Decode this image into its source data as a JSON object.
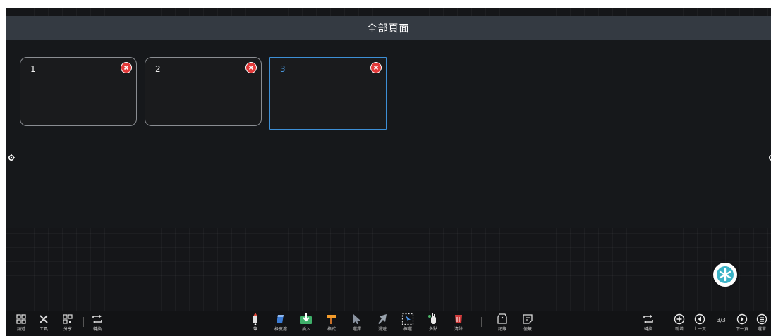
{
  "title": "全部頁面",
  "pages": [
    {
      "number": "1",
      "active": false
    },
    {
      "number": "2",
      "active": false
    },
    {
      "number": "3",
      "active": true
    }
  ],
  "toolbar": {
    "left": [
      {
        "icon": "grid-icon",
        "label": "頻道"
      },
      {
        "icon": "tools-icon",
        "label": "工具"
      },
      {
        "icon": "qrcode-icon",
        "label": "分享"
      },
      {
        "icon": "switch-icon",
        "label": "轉換"
      }
    ],
    "center": [
      {
        "icon": "pen-icon",
        "label": "筆"
      },
      {
        "icon": "eraser-icon",
        "label": "橡皮擦"
      },
      {
        "icon": "insert-icon",
        "label": "插入"
      },
      {
        "icon": "brush-icon",
        "label": "格式"
      },
      {
        "icon": "select-icon",
        "label": "選擇"
      },
      {
        "icon": "pointer-icon",
        "label": "漫遊"
      },
      {
        "icon": "lasso-icon",
        "label": "框選"
      },
      {
        "icon": "multitouch-icon",
        "label": "多點"
      },
      {
        "icon": "clear-icon",
        "label": "清除"
      },
      {
        "icon": "tag-icon",
        "label": "記錄"
      },
      {
        "icon": "note-icon",
        "label": "便簽"
      }
    ],
    "right": [
      {
        "icon": "switch-icon",
        "label": "轉換"
      },
      {
        "icon": "add-page-icon",
        "label": "新增"
      },
      {
        "icon": "prev-page-icon",
        "label": "上一頁"
      },
      {
        "icon": "next-page-icon",
        "label": "下一頁"
      },
      {
        "icon": "menu-icon",
        "label": "選單"
      }
    ],
    "page_indicator": "3/3"
  },
  "colors": {
    "board": "#151619",
    "title_bar": "#343a42",
    "active_border": "#3d8fd6",
    "close": "#e23a3a",
    "fab": "#3bb3c7"
  }
}
